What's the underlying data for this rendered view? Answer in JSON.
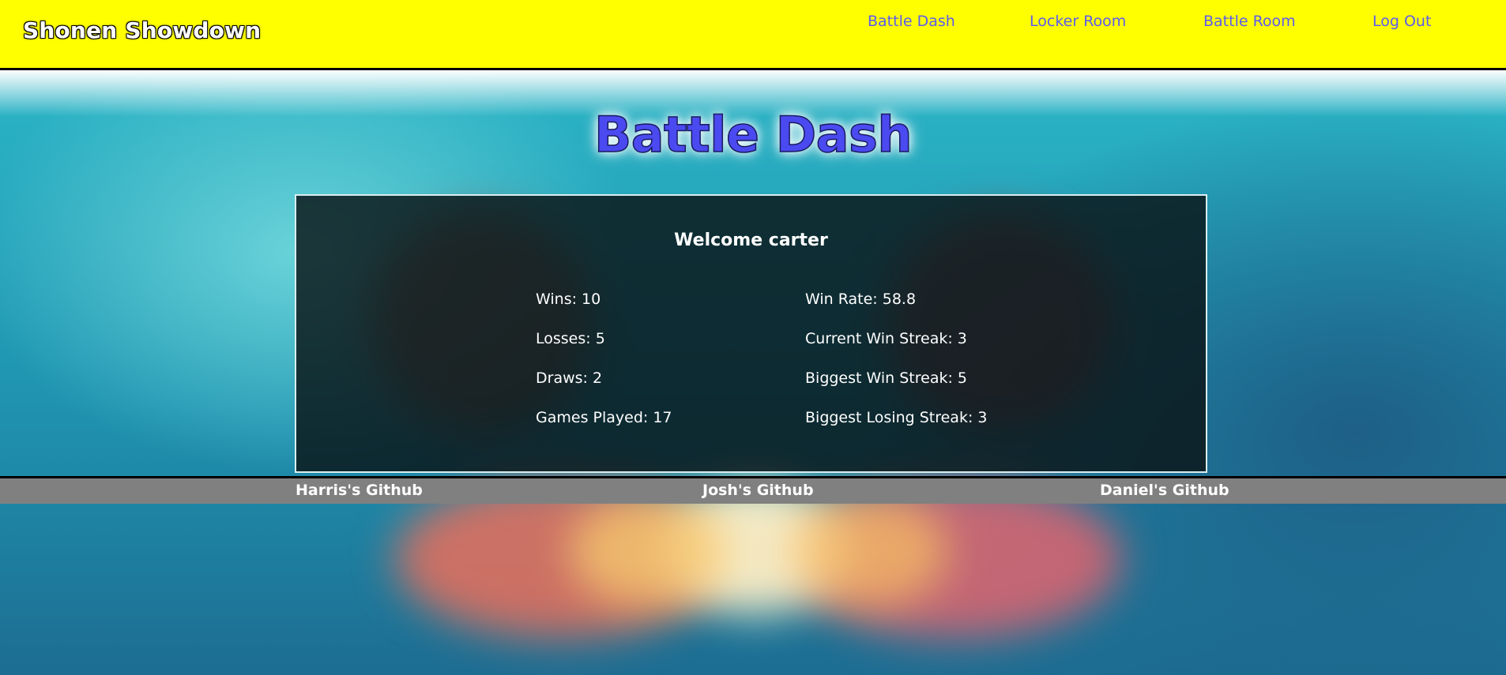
{
  "header": {
    "brand": "Shonen Showdown",
    "nav": [
      {
        "label": "Battle Dash"
      },
      {
        "label": "Locker Room"
      },
      {
        "label": "Battle Room"
      },
      {
        "label": "Log Out"
      }
    ]
  },
  "main": {
    "title": "Battle Dash",
    "welcome": "Welcome carter",
    "stats_left": [
      "Wins: 10",
      "Losses: 5",
      "Draws: 2",
      "Games Played: 17"
    ],
    "stats_right": [
      "Win Rate: 58.8",
      "Current Win Streak: 3",
      "Biggest Win Streak: 5",
      "Biggest Losing Streak: 3"
    ]
  },
  "footer": {
    "links": [
      {
        "label": "Harris's Github"
      },
      {
        "label": "Josh's Github"
      },
      {
        "label": "Daniel's Github"
      }
    ]
  },
  "colors": {
    "header_bg": "#ffff00",
    "nav_link": "#5b5bf0",
    "title": "#4a4af0",
    "footer_bg": "#808080"
  }
}
